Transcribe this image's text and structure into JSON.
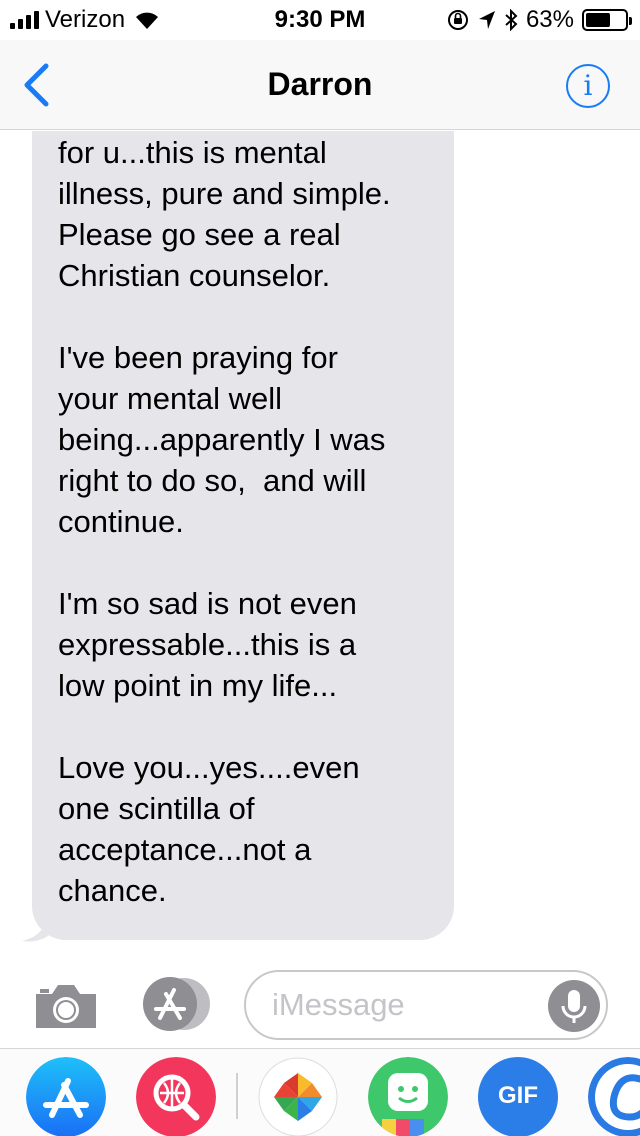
{
  "status_bar": {
    "carrier": "Verizon",
    "time": "9:30 PM",
    "battery_percent": "63%",
    "battery_level": 0.63,
    "signal_bars": 4,
    "icons": [
      "signal-icon",
      "wifi-icon",
      "orientation-lock-icon",
      "location-arrow-icon",
      "bluetooth-icon",
      "battery-icon"
    ]
  },
  "nav": {
    "title": "Darron",
    "back_icon": "chevron-left-icon",
    "info_icon": "info-icon",
    "info_glyph": "i"
  },
  "conversation": {
    "messages": [
      {
        "direction": "incoming",
        "text": "tracks...im simply sorry\nfor u...this is mental\nillness, pure and simple.\nPlease go see a real\nChristian counselor.\n\nI've been praying for\nyour mental well\nbeing...apparently I was\nright to do so,  and will\ncontinue.\n\nI'm so sad is not even\nexpressable...this is a\nlow point in my life...\n\nLove you...yes....even\none scintilla of\nacceptance...not a\nchance."
      }
    ]
  },
  "input_bar": {
    "placeholder": "iMessage",
    "value": "",
    "icons": [
      "camera-icon",
      "app-store-icon",
      "microphone-icon"
    ]
  },
  "app_drawer": {
    "apps": [
      "app-store-icon",
      "web-search-icon",
      "photos-icon",
      "bitmoji-icon",
      "gif-icon",
      "cursive-c-icon"
    ],
    "gif_label": "GIF"
  },
  "colors": {
    "accent": "#1a7cf5",
    "bubble_incoming": "#e5e5ea",
    "icon_gray": "#8e8e93"
  }
}
